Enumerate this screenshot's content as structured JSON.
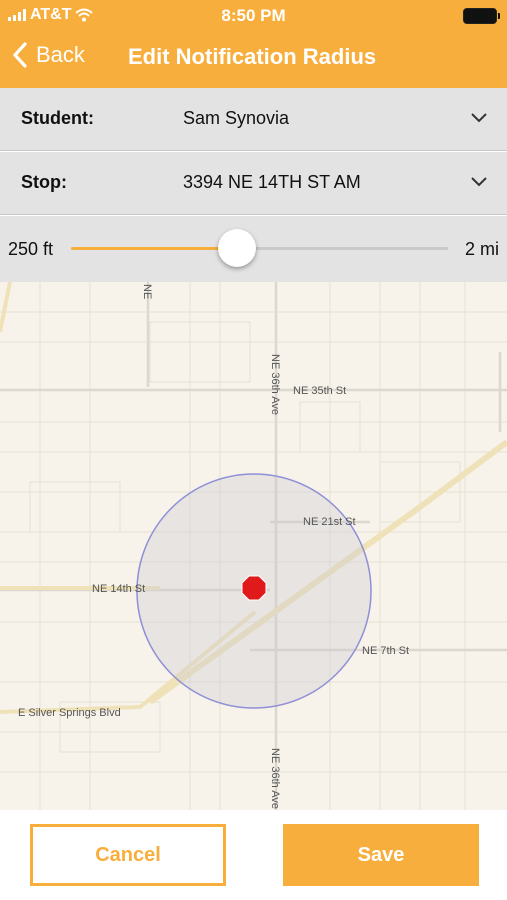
{
  "status_bar": {
    "carrier": "AT&T",
    "time": "8:50 PM"
  },
  "nav": {
    "back_label": "Back",
    "title": "Edit Notification Radius"
  },
  "student": {
    "label": "Student:",
    "value": "Sam Synovia"
  },
  "stop": {
    "label": "Stop:",
    "value": "3394 NE 14TH ST AM"
  },
  "radius_slider": {
    "min_label": "250 ft",
    "max_label": "2 mi",
    "value_fraction": 0.44
  },
  "map": {
    "labels": {
      "ne_35th": "NE 35th St",
      "ne_36th_top": "NE 36th Ave",
      "ne_36th_bottom": "NE 36th Ave",
      "ne_21st": "NE 21st St",
      "ne_14th": "NE 14th St",
      "ne_7th": "NE 7th St",
      "silver_springs": "E Silver Springs Blvd",
      "ne_partial": "NE"
    }
  },
  "buttons": {
    "cancel": "Cancel",
    "save": "Save"
  },
  "colors": {
    "accent": "#F8AE3C",
    "stop_marker": "#E0191B",
    "radius_circle": "#8F8FD6"
  }
}
